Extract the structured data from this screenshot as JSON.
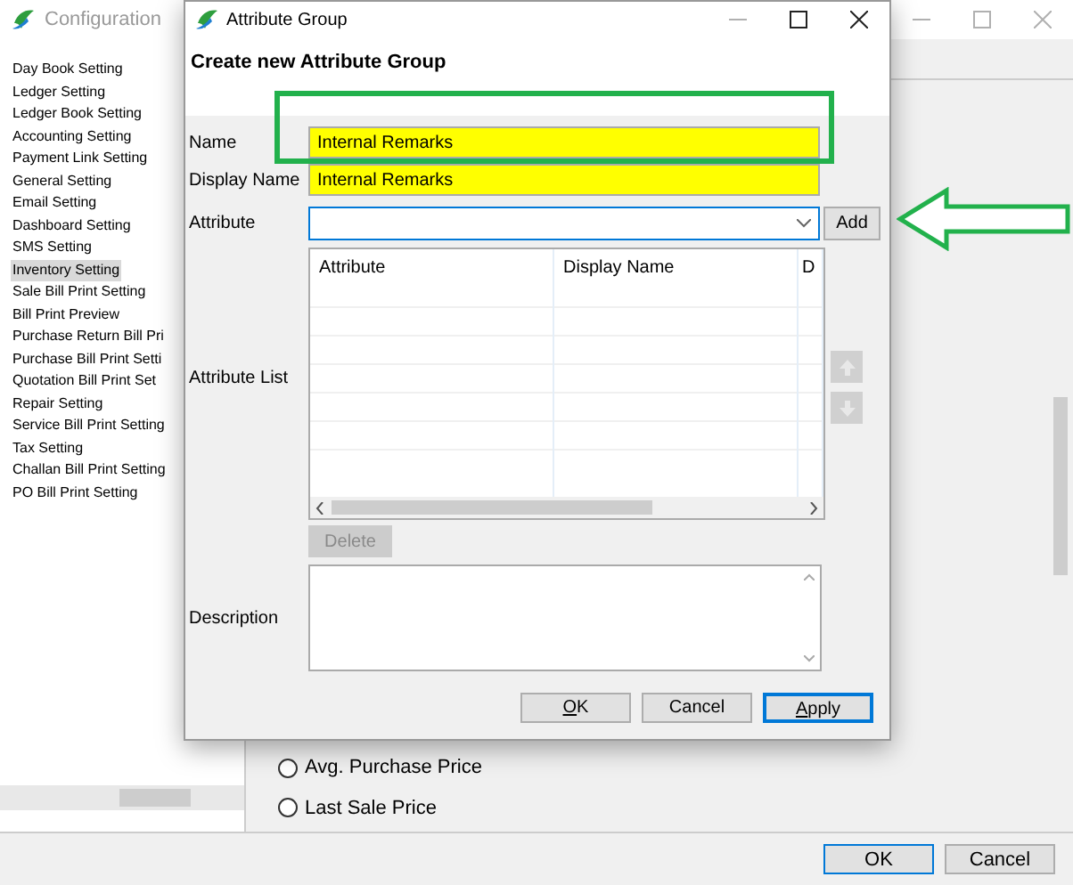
{
  "background_window": {
    "title": "Configuration",
    "sidebar": {
      "items": [
        {
          "label": "Day Book Setting",
          "selected": false
        },
        {
          "label": "Ledger Setting",
          "selected": false
        },
        {
          "label": "Ledger Book Setting",
          "selected": false
        },
        {
          "label": "Accounting Setting",
          "selected": false
        },
        {
          "label": "Payment Link Setting",
          "selected": false
        },
        {
          "label": "General Setting",
          "selected": false
        },
        {
          "label": "Email Setting",
          "selected": false
        },
        {
          "label": "Dashboard Setting",
          "selected": false
        },
        {
          "label": "SMS Setting",
          "selected": false
        },
        {
          "label": "Inventory Setting",
          "selected": true
        },
        {
          "label": "Sale Bill Print Setting",
          "selected": false
        },
        {
          "label": "Bill Print Preview",
          "selected": false
        },
        {
          "label": "Purchase Return Bill Pri",
          "selected": false
        },
        {
          "label": "Purchase Bill Print Setti",
          "selected": false
        },
        {
          "label": "Quotation Bill Print Set",
          "selected": false
        },
        {
          "label": "Repair Setting",
          "selected": false
        },
        {
          "label": "Service Bill Print Setting",
          "selected": false
        },
        {
          "label": "Tax Setting",
          "selected": false
        },
        {
          "label": "Challan Bill Print Setting",
          "selected": false
        },
        {
          "label": "PO Bill Print Setting",
          "selected": false
        }
      ]
    },
    "price_options": [
      {
        "label": "Avg. Purchase Price",
        "selected": false
      },
      {
        "label": "Last Sale Price",
        "selected": false
      }
    ],
    "buttons": [
      {
        "label": "OK",
        "default": true
      },
      {
        "label": "Cancel",
        "default": false
      }
    ]
  },
  "dialog": {
    "title": "Attribute Group",
    "heading": "Create new Attribute Group",
    "fields": [
      {
        "kind": "text",
        "label": "Name",
        "value": "Internal Remarks",
        "highlighted": true
      },
      {
        "kind": "text",
        "label": "Display Name",
        "value": "Internal Remarks",
        "highlighted": true
      },
      {
        "kind": "combo",
        "label": "Attribute",
        "highlighted": false
      }
    ],
    "add_button": {
      "label": "Add"
    },
    "attribute_list": {
      "label": "Attribute List",
      "columns": [
        "Attribute",
        "Display Name",
        "D"
      ]
    },
    "delete_button": {
      "label": "Delete",
      "disabled": true
    },
    "description": {
      "label": "Description"
    },
    "buttons": [
      {
        "label": "OK",
        "default": false,
        "underline_first": true
      },
      {
        "label": "Cancel",
        "default": false,
        "underline_first": false
      },
      {
        "label": "Apply",
        "default": true,
        "underline_first": true
      }
    ]
  }
}
